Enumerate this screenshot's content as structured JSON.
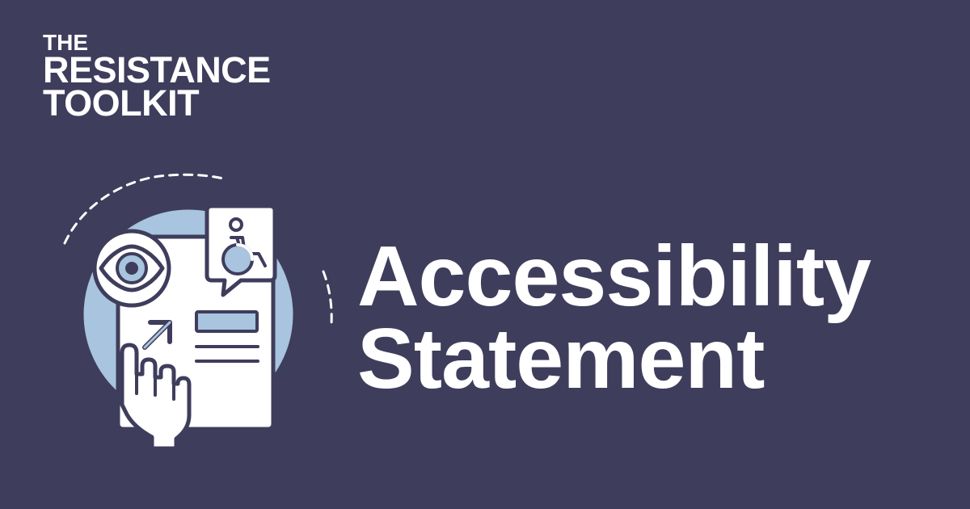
{
  "logo": {
    "line1": "THE",
    "line2": "RESISTANCE",
    "line3": "TOOLKIT"
  },
  "headline": {
    "line1": "Accessibility",
    "line2": "Statement"
  },
  "colors": {
    "background": "#3f3d5c",
    "text": "#ffffff",
    "accent_light_blue": "#a8c4de",
    "line_navy": "#3f3d5c",
    "card_white": "#ffffff"
  },
  "icons": {
    "eye": "eye-icon",
    "wheelchair": "wheelchair-icon",
    "hand": "pointing-hand-icon",
    "arrow": "arrow-up-right-icon"
  }
}
